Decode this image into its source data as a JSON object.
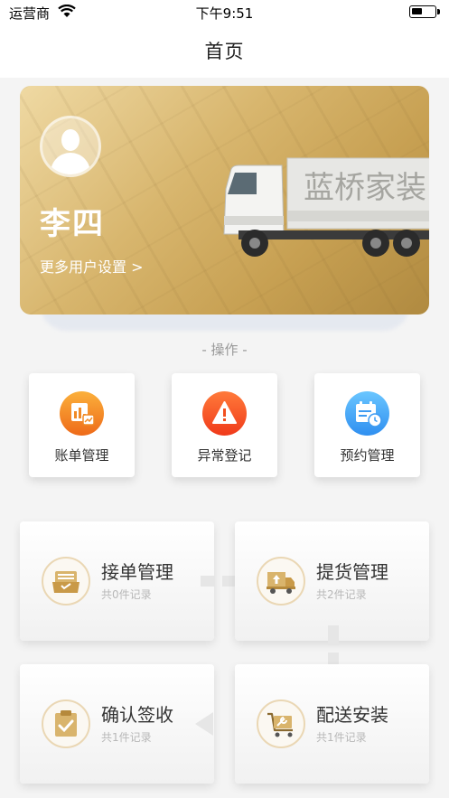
{
  "status_bar": {
    "carrier": "运营商",
    "time": "下午9:51",
    "icons": [
      "wifi-icon",
      "battery-icon"
    ]
  },
  "navbar": {
    "title": "首页"
  },
  "banner": {
    "username": "李四",
    "more_settings": "更多用户设置 >",
    "truck_text": "蓝桥家装",
    "colors": {
      "gold": "#d8b66e"
    }
  },
  "section": {
    "title": "- 操作 -"
  },
  "quick_actions": [
    {
      "label": "账单管理",
      "icon": "bill-chart-icon",
      "color": "#f08a26"
    },
    {
      "label": "异常登记",
      "icon": "warning-icon",
      "color": "#f24e1e"
    },
    {
      "label": "预约管理",
      "icon": "calendar-clock-icon",
      "color": "#3d9bf2"
    }
  ],
  "workflow": [
    {
      "title": "接单管理",
      "sub": "共0件记录",
      "icon": "order-box-icon"
    },
    {
      "title": "提货管理",
      "sub": "共2件记录",
      "icon": "truck-upload-icon"
    },
    {
      "title": "确认签收",
      "sub": "共1件记录",
      "icon": "clipboard-check-icon"
    },
    {
      "title": "配送安装",
      "sub": "共1件记录",
      "icon": "tools-cart-icon"
    }
  ]
}
